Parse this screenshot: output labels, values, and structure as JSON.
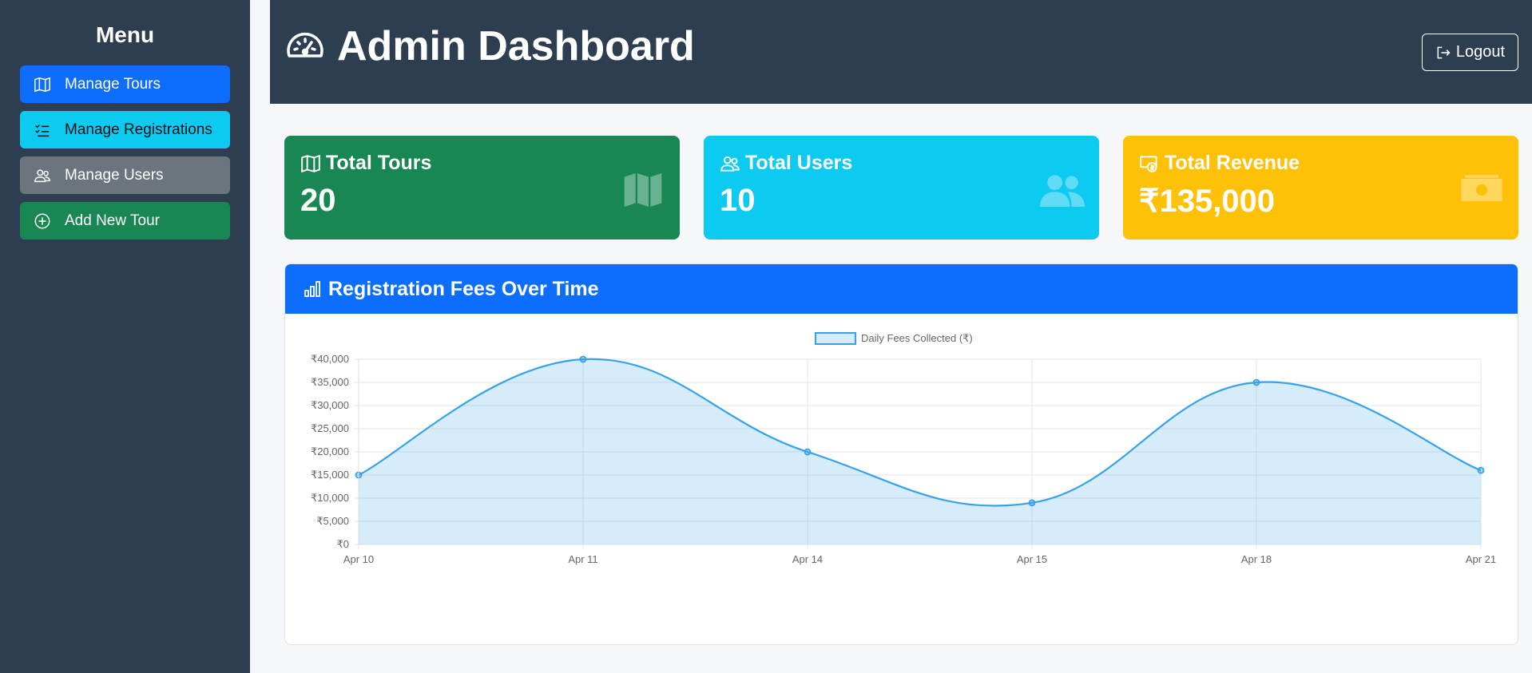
{
  "sidebar": {
    "title": "Menu",
    "items": [
      {
        "label": "Manage Tours",
        "color": "#0d6efd",
        "icon": "map-icon"
      },
      {
        "label": "Manage Registrations",
        "color": "#0dcaf0",
        "icon": "list-check-icon"
      },
      {
        "label": "Manage Users",
        "color": "#6c757d",
        "icon": "people-icon"
      },
      {
        "label": "Add New Tour",
        "color": "#198754",
        "icon": "plus-circle-icon"
      }
    ]
  },
  "header": {
    "title": "Admin Dashboard",
    "icon": "speedometer-icon",
    "logout_label": "Logout"
  },
  "stats": [
    {
      "label": "Total Tours",
      "value": "20",
      "color": "#198754",
      "icon": "map-icon"
    },
    {
      "label": "Total Users",
      "value": "10",
      "color": "#0dcaf0",
      "icon": "people-icon"
    },
    {
      "label": "Total Revenue",
      "value": "₹135,000",
      "color": "#ffc107",
      "icon": "cash-icon"
    }
  ],
  "chart_panel": {
    "title": "Registration Fees Over Time",
    "icon": "bar-chart-icon"
  },
  "chart_data": {
    "type": "area",
    "categories": [
      "Apr 10",
      "Apr 11",
      "Apr 14",
      "Apr 15",
      "Apr 18",
      "Apr 21"
    ],
    "series": [
      {
        "name": "Daily Fees Collected (₹)",
        "values": [
          15000,
          40000,
          20000,
          9000,
          35000,
          16000
        ],
        "color": "#36a2eb"
      }
    ],
    "ylim": [
      0,
      40000
    ],
    "yticks": [
      "₹0",
      "₹5,000",
      "₹10,000",
      "₹15,000",
      "₹20,000",
      "₹25,000",
      "₹30,000",
      "₹35,000",
      "₹40,000"
    ],
    "legend_position": "top-center",
    "grid": true
  }
}
